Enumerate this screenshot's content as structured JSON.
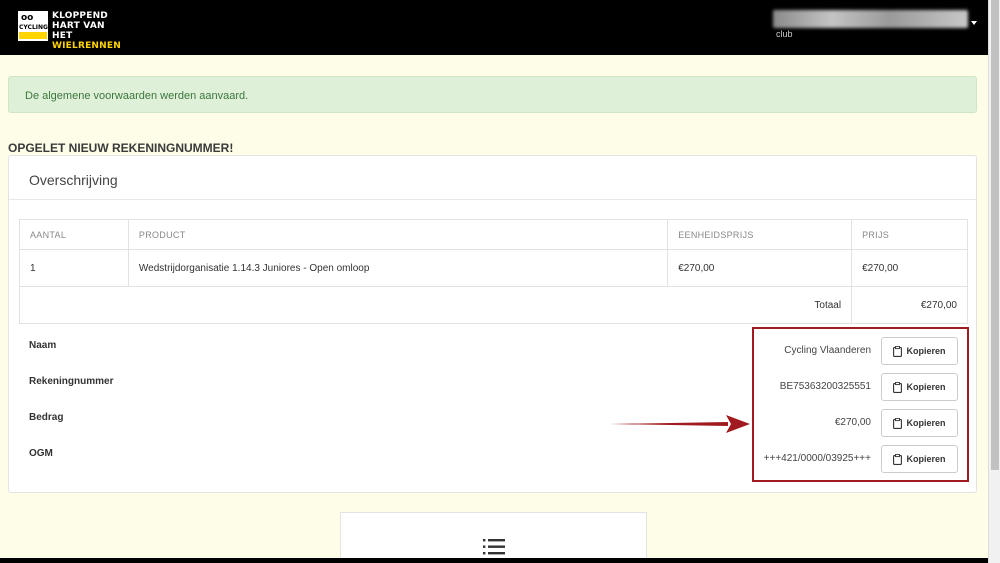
{
  "header": {
    "logo": {
      "line1": "KLOPPEND",
      "line2": "HART VAN HET",
      "line3": "WIELRENNEN",
      "badge_text": "CYCLING"
    },
    "user": {
      "role": "club"
    }
  },
  "alert": {
    "message": "De algemene voorwaarden werden aanvaard."
  },
  "notice": "OPGELET NIEUW REKENINGNUMMER!",
  "panel": {
    "title": "Overschrijving",
    "table": {
      "headers": [
        "AANTAL",
        "PRODUCT",
        "EENHEIDSPRIJS",
        "PRIJS"
      ],
      "rows": [
        {
          "aantal": "1",
          "product": "Wedstrijdorganisatie 1.14.3 Juniores - Open omloop",
          "eenheidsprijs": "€270,00",
          "prijs": "€270,00"
        }
      ],
      "total_label": "Totaal",
      "total_value": "€270,00"
    },
    "details": [
      {
        "label": "Naam",
        "value": "Cycling Vlaanderen",
        "button": "Kopieren"
      },
      {
        "label": "Rekeningnummer",
        "value": "BE75363200325551",
        "button": "Kopieren"
      },
      {
        "label": "Bedrag",
        "value": "€270,00",
        "button": "Kopieren"
      },
      {
        "label": "OGM",
        "value": "+++421/0000/03925+++",
        "button": "Kopieren"
      }
    ]
  },
  "colors": {
    "highlight": "#a01a1f",
    "brand_yellow": "#ffd400",
    "alert_bg": "#dff0d8"
  },
  "icons": [
    "clipboard-icon",
    "menu-icon",
    "caret-down-icon",
    "arrow-annotation"
  ]
}
